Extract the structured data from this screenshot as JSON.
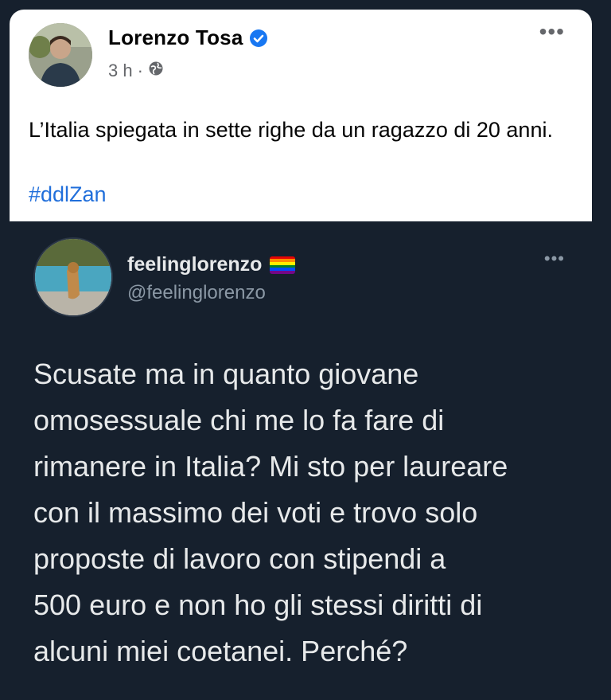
{
  "facebook_post": {
    "author": "Lorenzo Tosa",
    "time": "3 h",
    "separator": "·",
    "text": "L’Italia spiegata in sette righe da un ragazzo di 20 anni.",
    "hashtag": "#ddlZan",
    "more_label": "•••"
  },
  "tweet": {
    "display_name": "feelinglorenzo",
    "handle": "@feelinglorenzo",
    "more_label": "•••",
    "text": "Scusate ma in quanto giovane\nomosessuale chi me lo fa fare di\nrimanere in Italia? Mi sto per laureare\ncon il massimo dei voti e trovo solo\nproposte di lavoro con stipendi a\n500 euro e non ho gli stessi diritti di\nalcuni miei coetanei. Perché?"
  },
  "icons": {
    "verified": "verified-badge-icon",
    "globe": "globe-icon",
    "rainbow": "rainbow-flag-icon"
  },
  "colors": {
    "facebook_bg": "#ffffff",
    "tweet_bg": "#16202d",
    "verified_blue": "#1877f2",
    "hashtag_blue": "#216fdb",
    "tweet_text": "#e7e9ea",
    "tweet_secondary": "#8b98a5"
  }
}
